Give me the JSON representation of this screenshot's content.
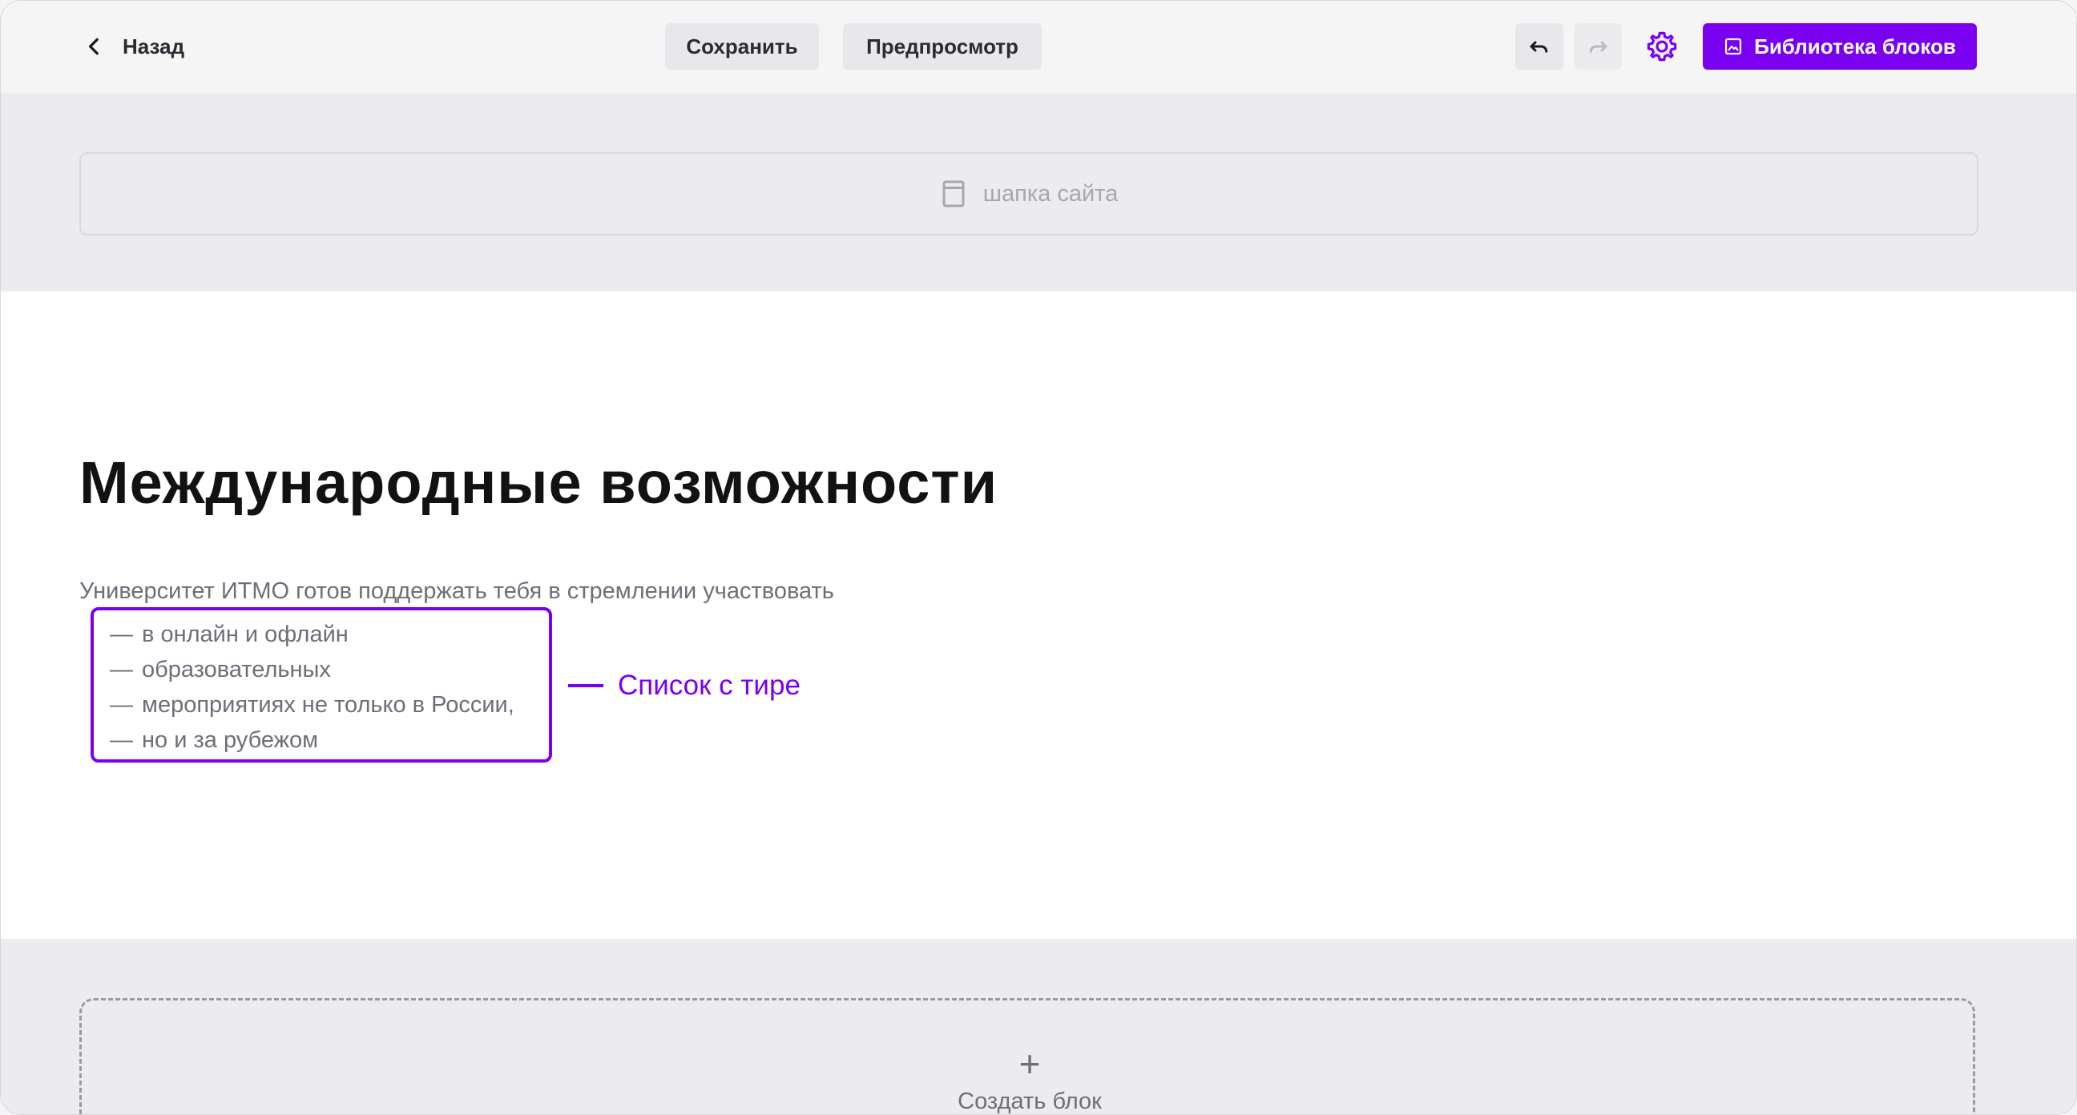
{
  "toolbar": {
    "back_label": "Назад",
    "save_label": "Сохранить",
    "preview_label": "Предпросмотр",
    "library_label": "Библиотека блоков",
    "accent_color": "#7a00f0",
    "icons": [
      "chevron-left-icon",
      "undo-icon",
      "redo-icon",
      "gear-icon",
      "image-icon"
    ]
  },
  "header_block": {
    "label": "шапка сайта",
    "icon": "page-icon"
  },
  "content": {
    "title": "Международные возможности",
    "lead": "Университет ИТМО готов поддержать тебя в стремлении участвовать",
    "list": [
      {
        "dash": "—",
        "text": "в онлайн и офлайн"
      },
      {
        "dash": "—",
        "text": "образовательных"
      },
      {
        "dash": "—",
        "text": "мероприятиях не только в России,"
      },
      {
        "dash": "—",
        "text": "но и за рубежом"
      }
    ],
    "callout": "Список с тире"
  },
  "create_block": {
    "plus": "+",
    "label": "Создать блок"
  }
}
